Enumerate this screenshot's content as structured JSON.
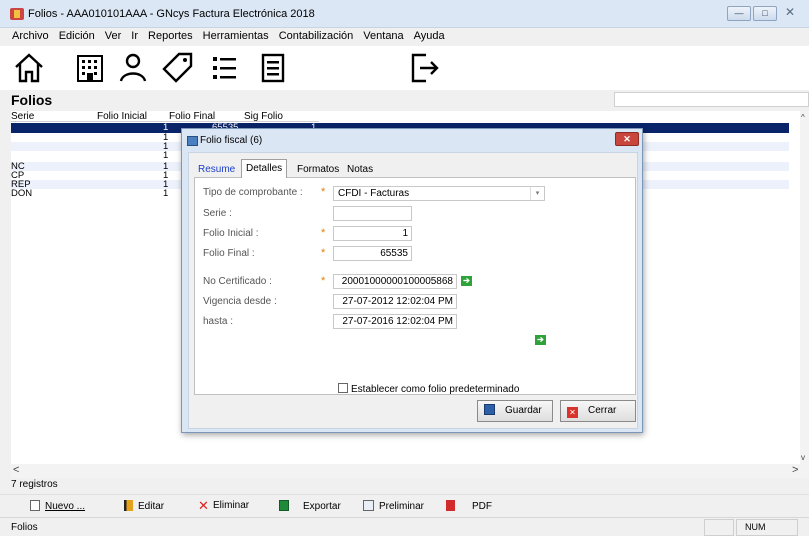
{
  "window": {
    "title": "Folios - AAA010101AAA - GNcys Factura Electrónica 2018",
    "btn_min": "—",
    "btn_max": "□",
    "btn_close": "✕"
  },
  "menu": [
    "Archivo",
    "Edición",
    "Ver",
    "Ir",
    "Reportes",
    "Herramientas",
    "Contabilización",
    "Ventana",
    "Ayuda"
  ],
  "toolbar_icons": [
    "home-icon",
    "building-icon",
    "person-icon",
    "tag-icon",
    "list-icon",
    "document-icon",
    "exit-icon"
  ],
  "page_title": "Folios",
  "grid": {
    "columns": [
      "Serie",
      "Folio Inicial",
      "Folio Final",
      "Sig Folio"
    ],
    "rows": [
      {
        "serie": "",
        "inicial": "1",
        "final": "65535",
        "sig": "1"
      },
      {
        "serie": "",
        "inicial": "1",
        "final": "",
        "sig": ""
      },
      {
        "serie": "",
        "inicial": "1",
        "final": "",
        "sig": ""
      },
      {
        "serie": "",
        "inicial": "1",
        "final": "",
        "sig": ""
      },
      {
        "serie": "NC",
        "inicial": "1",
        "final": "",
        "sig": ""
      },
      {
        "serie": "CP",
        "inicial": "1",
        "final": "",
        "sig": ""
      },
      {
        "serie": "REP",
        "inicial": "1",
        "final": "",
        "sig": ""
      },
      {
        "serie": "DON",
        "inicial": "1",
        "final": "",
        "sig": ""
      }
    ]
  },
  "scroll": {
    "up": "^",
    "down": "v",
    "left": "<",
    "right": ">"
  },
  "record_count": "7 registros",
  "actions": {
    "nuevo": "Nuevo ...",
    "editar": "Editar",
    "eliminar": "Eliminar",
    "exportar": "Exportar",
    "preliminar": "Preliminar",
    "pdf": "PDF"
  },
  "status": {
    "left": "Folios",
    "num": "NUM"
  },
  "dialog": {
    "title": "Folio fiscal (6)",
    "close": "✕",
    "tabs": [
      "Resume",
      "Detalles",
      "Formatos",
      "Notas"
    ],
    "labels": {
      "tipo": "Tipo de comprobante :",
      "serie": "Serie :",
      "folio_inicial": "Folio Inicial :",
      "folio_final": "Folio Final :",
      "no_cert": "No Certificado :",
      "vig_desde": "Vigencia desde :",
      "hasta": "hasta :"
    },
    "values": {
      "tipo": "CFDI - Facturas",
      "serie": "",
      "folio_inicial": "1",
      "folio_final": "65535",
      "no_cert": "20001000000100005868",
      "vig_desde": "27-07-2012 12:02:04 PM",
      "hasta": "27-07-2016 12:02:04 PM"
    },
    "required_mark": "*",
    "combo_arrow": "▾",
    "go": "➔",
    "checkbox_label": "Establecer como folio predeterminado",
    "save_label": "Guardar",
    "close_label": "Cerrar"
  },
  "colors": {
    "selection": "#0a246a",
    "accent_link": "#1a3fc9",
    "required": "#e08000",
    "go_green": "#2fa33a"
  }
}
